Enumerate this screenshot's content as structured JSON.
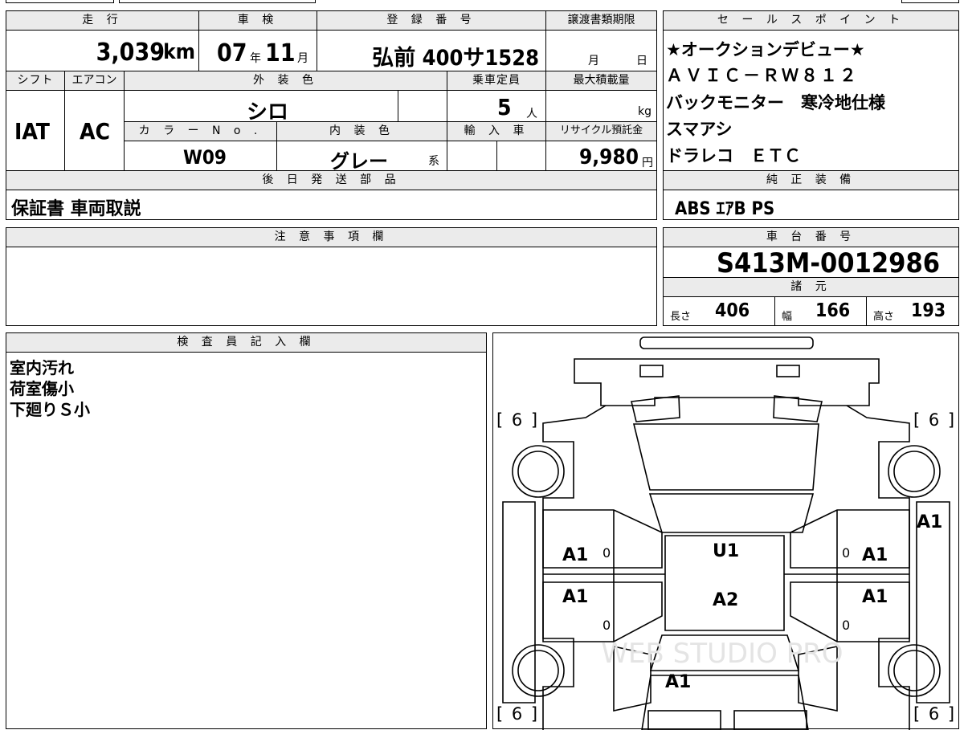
{
  "top_left": {
    "headers": {
      "mileage": "走 行",
      "inspection": "車 検",
      "registration": "登 録 番 号",
      "doc_deadline": "譲渡書類期限",
      "shift": "シフト",
      "aircon": "エアコン",
      "exterior_color": "外 装 色",
      "capacity": "乗車定員",
      "max_load": "最大積載量",
      "color_no": "カ ラ ー N o .",
      "interior_color": "内 装 色",
      "import": "輸 入 車",
      "recycle": "リサイクル預託金",
      "later_parts": "後 日 発 送 部 品"
    },
    "mileage_value": "3,039",
    "mileage_unit": "km",
    "inspection_year": "07",
    "inspection_year_unit": "年",
    "inspection_month": "11",
    "inspection_month_unit": "月",
    "registration_value": "弘前 400サ1528",
    "doc_month_unit": "月",
    "doc_day_unit": "日",
    "shift_value": "IAT",
    "aircon_value": "AC",
    "exterior_color_value": "シロ",
    "capacity_value": "5",
    "capacity_unit": "人",
    "max_load_unit": "kg",
    "color_no_value": "W09",
    "interior_color_value": "グレー",
    "interior_color_suffix": "系",
    "recycle_value": "9,980",
    "recycle_unit": "円",
    "later_parts_value": "保証書 車両取説"
  },
  "sales_points": {
    "header": "セ ー ル ス ポ イ ン ト",
    "lines": [
      "★オークションデビュー★",
      "ＡＶＩＣ－ＲＷ８１２",
      "バックモニター　寒冷地仕様",
      "スマアシ",
      "ドラレコ　ＥＴＣ"
    ]
  },
  "genuine_equipment": {
    "header": "純 正 装 備",
    "value": "ABS ｴｱB PS"
  },
  "notes": {
    "header": "注 意 事 項 欄",
    "value": ""
  },
  "chassis": {
    "header": "車 台 番 号",
    "value": "S413M-0012986",
    "specs_header": "諸 元",
    "length_label": "長さ",
    "length_value": "406",
    "width_label": "幅",
    "width_value": "166",
    "height_label": "高さ",
    "height_value": "193"
  },
  "inspector": {
    "header": "検 査 員 記 入 欄",
    "lines": [
      "室内汚れ",
      "荷室傷小",
      "下廻りＳ小"
    ]
  },
  "diagram": {
    "tire_tl": "[ 6 ]",
    "tire_tr": "[ 6 ]",
    "tire_bl": "[ 6 ]",
    "tire_br": "[ 6 ]",
    "marks": {
      "right_side": "A1",
      "left_front_door": "A1",
      "left_rear_door": "A1",
      "right_front_door": "A1",
      "right_rear_door": "A1",
      "roof": "U1",
      "roof_rear": "A2",
      "hood": "A1",
      "zero_l1": "0",
      "zero_l2": "0",
      "zero_r1": "0",
      "zero_r2": "0"
    },
    "watermark": "WEB STUDIO PRO"
  }
}
